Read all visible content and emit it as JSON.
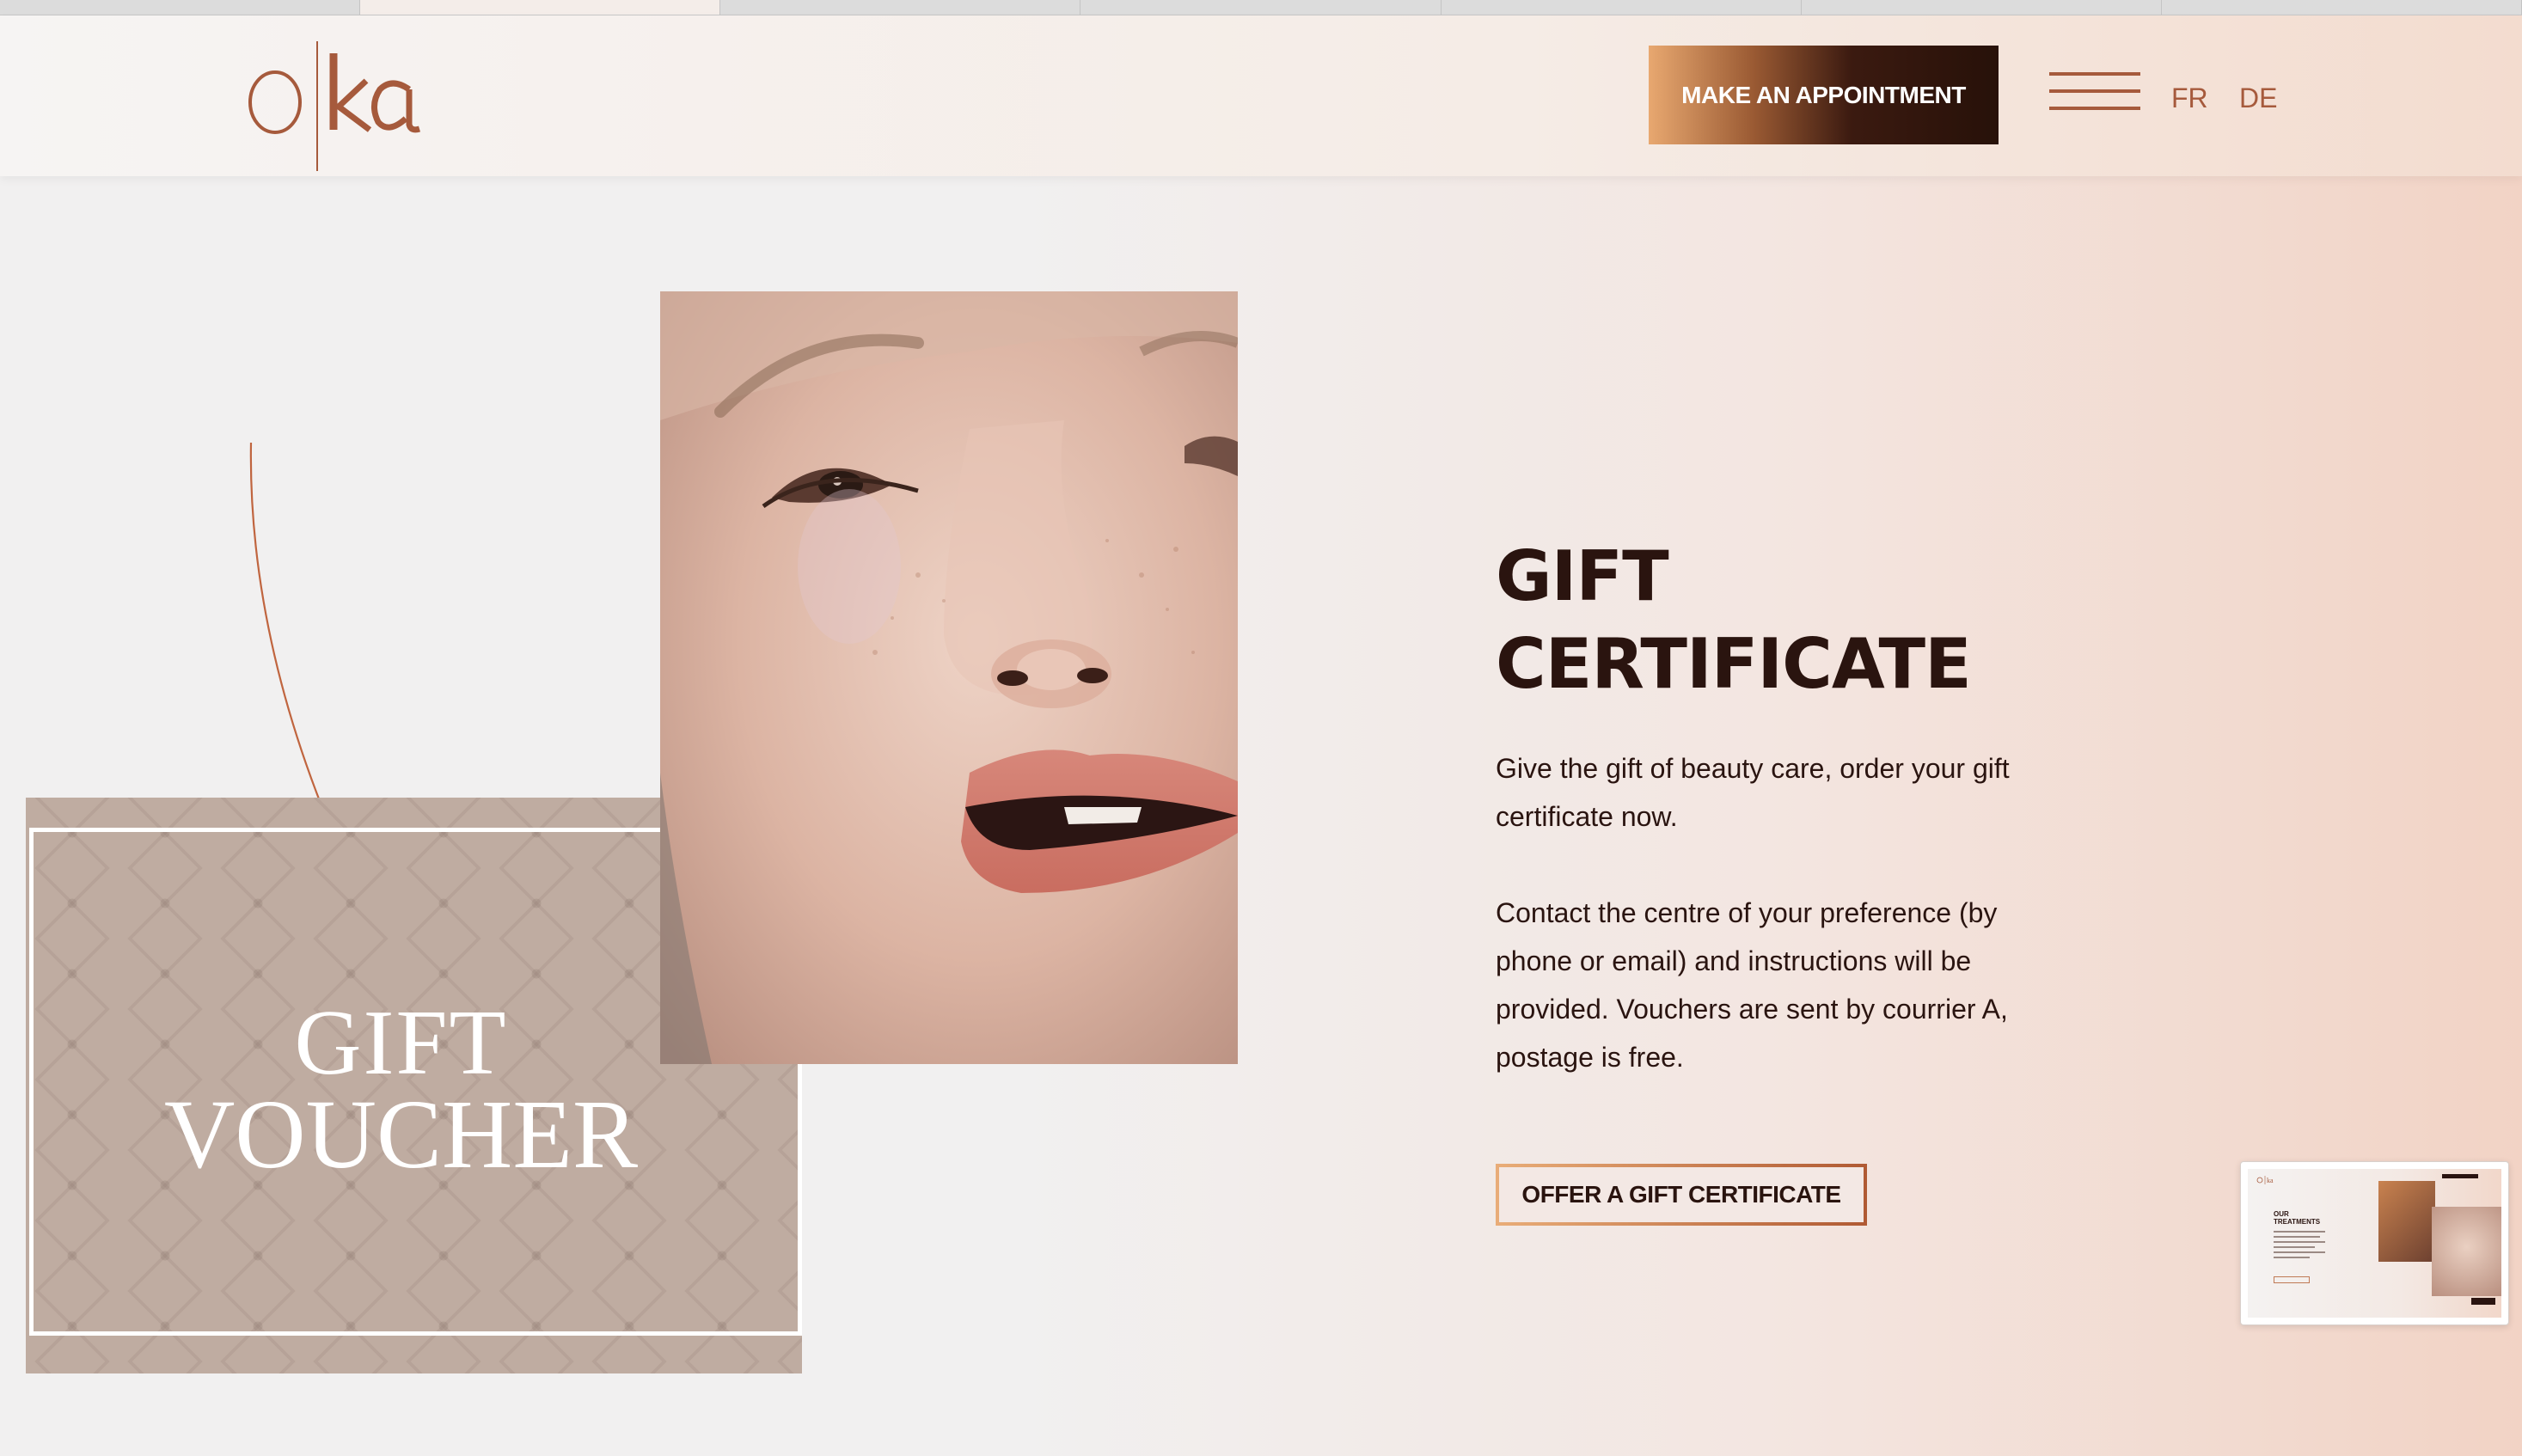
{
  "header": {
    "logo_text": "o|ka",
    "appointment_label": "MAKE AN APPOINTMENT",
    "menu_icon": "hamburger-menu-icon",
    "languages": [
      "FR",
      "DE"
    ]
  },
  "voucher": {
    "line1": "GIFT",
    "line2": "VOUCHER"
  },
  "main": {
    "title_line1": "GIFT",
    "title_line2": "CERTIFICATE",
    "paragraph1": "Give the gift of beauty care, order your gift certificate now.",
    "paragraph2": "Contact the centre of your preference (by phone or email) and instructions will be provided. Vouchers are sent by courrier A, postage is free.",
    "cta_label": "OFFER A GIFT CERTIFICATE"
  },
  "preview_thumbnail": {
    "heading": "OUR TREATMENTS"
  },
  "colors": {
    "accent": "#a65a3c",
    "dark": "#2a140f",
    "voucher_bg": "#bfaca1"
  }
}
